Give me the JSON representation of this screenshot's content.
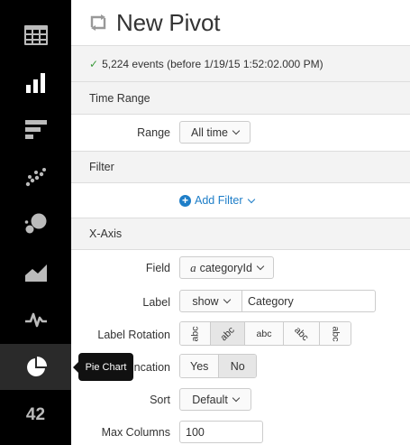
{
  "sidebar": {
    "items": [
      {
        "name": "table-icon"
      },
      {
        "name": "column-chart-icon"
      },
      {
        "name": "bar-chart-icon"
      },
      {
        "name": "scatter-chart-icon"
      },
      {
        "name": "bubble-chart-icon"
      },
      {
        "name": "area-chart-icon"
      },
      {
        "name": "line-chart-icon"
      },
      {
        "name": "pie-chart-icon",
        "active": true
      },
      {
        "name": "single-value",
        "label": "42"
      }
    ],
    "tooltip": "Pie Chart"
  },
  "header": {
    "title": "New Pivot"
  },
  "status": {
    "text": "5,224 events (before 1/19/15 1:52:02.000 PM)"
  },
  "time_range": {
    "title": "Time Range",
    "range_label": "Range",
    "range_value": "All time"
  },
  "filter": {
    "title": "Filter",
    "add_label": "Add Filter"
  },
  "x_axis": {
    "title": "X-Axis",
    "field_label": "Field",
    "field_prefix": "a",
    "field_value": "categoryId",
    "label_label": "Label",
    "label_mode": "show",
    "label_text": "Category",
    "rotation_label": "Label Rotation",
    "rotation_options": [
      "abc",
      "abc",
      "abc",
      "abc",
      "abc"
    ],
    "truncation_label": "Label Truncation",
    "truncation_yes": "Yes",
    "truncation_no": "No",
    "sort_label": "Sort",
    "sort_value": "Default",
    "max_columns_label": "Max Columns",
    "max_columns_value": "100"
  },
  "colors": {
    "accent": "#1e7ec8",
    "success": "#3c9b3c",
    "sidebar_bg": "#000000",
    "icon": "#bbbbbb"
  }
}
